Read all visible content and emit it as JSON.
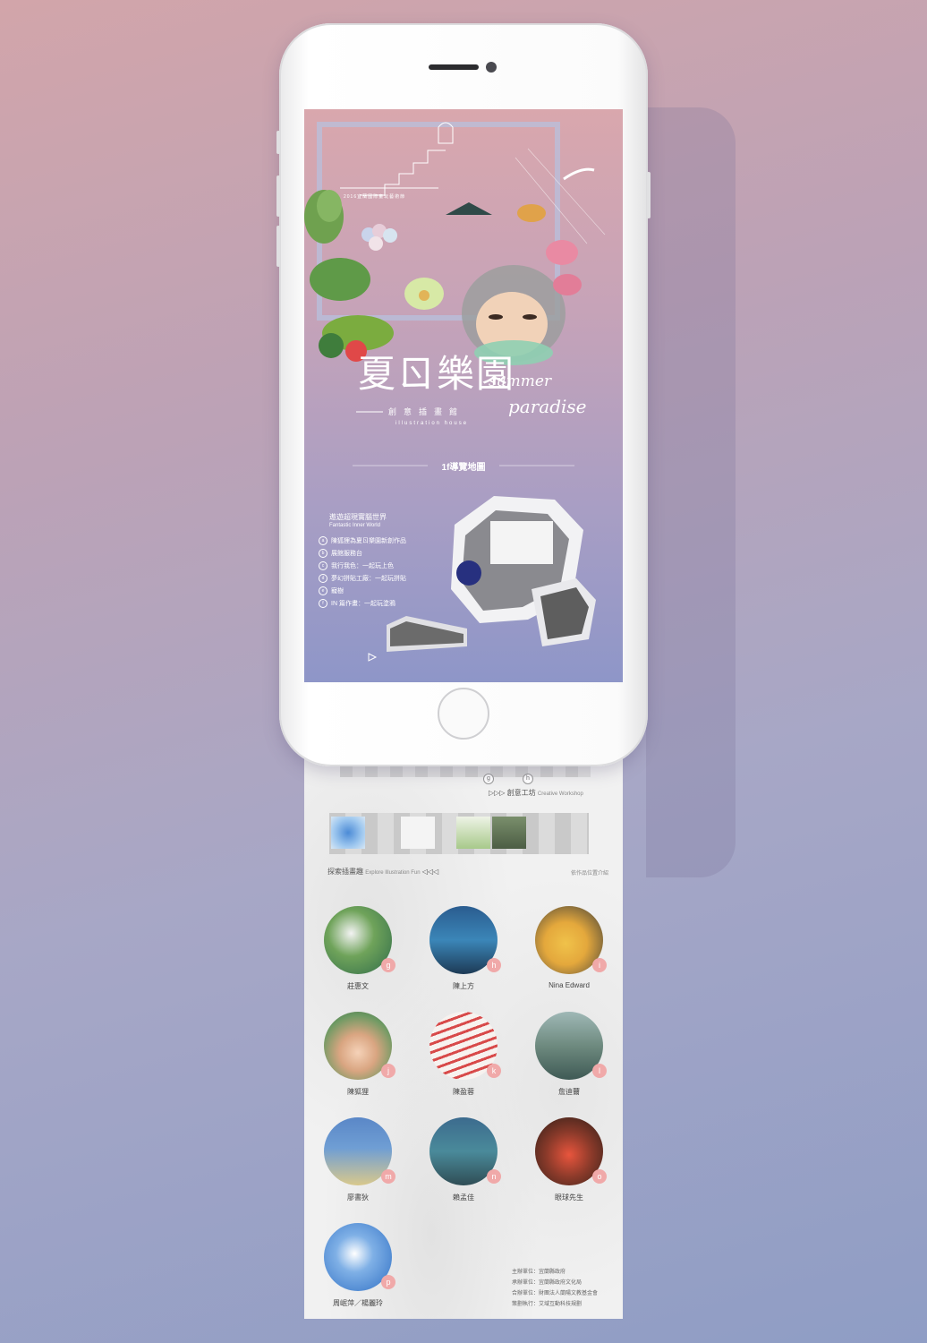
{
  "app": {
    "caption_year": "2016宜蘭國際童玩藝術節",
    "title_cn": "夏ㄖ樂園",
    "title_en_1": "summer",
    "title_en_2": "paradise",
    "subtitle_cn": "創意插畫館",
    "subtitle_en": "illustration house",
    "map_heading": "1f導覽地圖"
  },
  "section": {
    "title_cn": "遨遊超現實腦世界",
    "title_en": "Fantastic Inner World",
    "legend": [
      {
        "key": "a",
        "label": "陳狐狸為夏ㄖ樂園新創作品"
      },
      {
        "key": "b",
        "label": "展館服務台"
      },
      {
        "key": "c",
        "label": "我行我色：一起玩上色"
      },
      {
        "key": "d",
        "label": "夢幻拼貼工廠：一起玩拼貼"
      },
      {
        "key": "e",
        "label": "寵樹"
      },
      {
        "key": "f",
        "label": "IN 篇作畫：一起玩塗鴉"
      }
    ]
  },
  "scroll": {
    "strip_marks": [
      "g",
      "h"
    ],
    "workshop_label": "▷▷▷ 創意工坊",
    "workshop_en": "Creative Workshop",
    "explore_label": "探索插畫趣",
    "explore_en": "Explore Illustration Fun",
    "explore_arrows": "◁◁◁",
    "note": "依作品位置介紹",
    "artists": [
      {
        "key": "g",
        "name": "莊惠文"
      },
      {
        "key": "h",
        "name": "陳上方"
      },
      {
        "key": "i",
        "name": "Nina Edward"
      },
      {
        "key": "j",
        "name": "陳狐狸"
      },
      {
        "key": "k",
        "name": "陳盈蓉"
      },
      {
        "key": "l",
        "name": "詹迪薾"
      },
      {
        "key": "m",
        "name": "廖書狄"
      },
      {
        "key": "n",
        "name": "賴孟佳"
      },
      {
        "key": "o",
        "name": "眼球先生"
      },
      {
        "key": "p",
        "name": "周岷萍／楊麗玲"
      }
    ],
    "sponsors": [
      "主辦單位：宜蘭縣政府",
      "承辦單位：宜蘭縣政府文化局",
      "合辦單位：財團法人蘭陽文教基金會",
      "策劃執行：艾域互動科技規劃"
    ]
  },
  "colors": {
    "accent_badge": "#f0a9a9",
    "frame": "#b7c2e0"
  }
}
